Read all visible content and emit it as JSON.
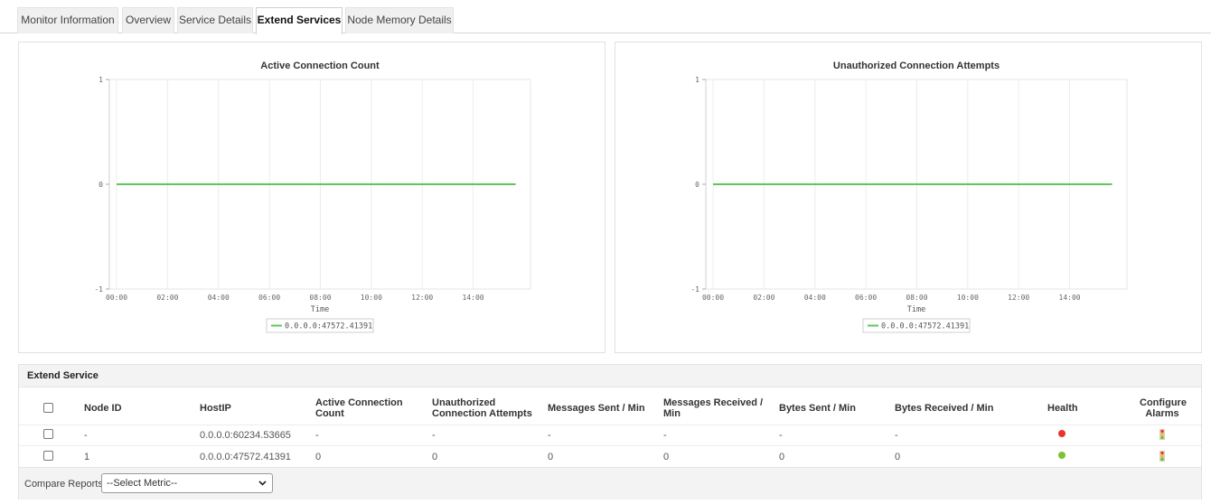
{
  "tabs": [
    {
      "label": "Monitor Information",
      "active": false
    },
    {
      "label": "Overview",
      "active": false
    },
    {
      "label": "Service Details",
      "active": false
    },
    {
      "label": "Extend Services",
      "active": true
    },
    {
      "label": "Node Memory Details",
      "active": false
    }
  ],
  "charts": [
    {
      "title": "Active Connection Count",
      "xlabel": "Time",
      "legend": "0.0.0.0:47572.41391"
    },
    {
      "title": "Unauthorized Connection Attempts",
      "xlabel": "Time",
      "legend": "0.0.0.0:47572.41391"
    }
  ],
  "chart_data": [
    {
      "type": "line",
      "title": "Active Connection Count",
      "xlabel": "Time",
      "ylabel": "",
      "x_ticks": [
        "00:00",
        "02:00",
        "04:00",
        "06:00",
        "08:00",
        "10:00",
        "12:00",
        "14:00"
      ],
      "y_ticks": [
        "1",
        "0",
        "-1"
      ],
      "ylim": [
        -1,
        1
      ],
      "grid": true,
      "legend_position": "bottom",
      "series": [
        {
          "name": "0.0.0.0:47572.41391",
          "color": "#5cc85c",
          "x": [
            "00:00",
            "15:40"
          ],
          "values": [
            0,
            0
          ]
        }
      ]
    },
    {
      "type": "line",
      "title": "Unauthorized Connection Attempts",
      "xlabel": "Time",
      "ylabel": "",
      "x_ticks": [
        "00:00",
        "02:00",
        "04:00",
        "06:00",
        "08:00",
        "10:00",
        "12:00",
        "14:00"
      ],
      "y_ticks": [
        "1",
        "0",
        "-1"
      ],
      "ylim": [
        -1,
        1
      ],
      "grid": true,
      "legend_position": "bottom",
      "series": [
        {
          "name": "0.0.0.0:47572.41391",
          "color": "#5cc85c",
          "x": [
            "00:00",
            "15:40"
          ],
          "values": [
            0,
            0
          ]
        }
      ]
    }
  ],
  "table": {
    "title": "Extend Service",
    "columns": {
      "node_id": "Node ID",
      "host_ip": "HostIP",
      "active_l1": "Active Connection",
      "active_l2": "Count",
      "unauth_l1": "Unauthorized",
      "unauth_l2": "Connection Attempts",
      "msg_sent": "Messages Sent / Min",
      "msg_recv_l1": "Messages Received /",
      "msg_recv_l2": "Min",
      "bytes_sent": "Bytes Sent / Min",
      "bytes_recv": "Bytes Received / Min",
      "health": "Health",
      "alarms_l1": "Configure",
      "alarms_l2": "Alarms"
    },
    "rows": [
      {
        "node_id": "-",
        "host_ip": "0.0.0.0:60234.53665",
        "active": "-",
        "unauth": "-",
        "msg_sent": "-",
        "msg_recv": "-",
        "bytes_sent": "-",
        "bytes_recv": "-",
        "health": "critical",
        "health_color": "#e8342a"
      },
      {
        "node_id": "1",
        "host_ip": "0.0.0.0:47572.41391",
        "active": "0",
        "unauth": "0",
        "msg_sent": "0",
        "msg_recv": "0",
        "bytes_sent": "0",
        "bytes_recv": "0",
        "health": "clear",
        "health_color": "#7cc42e"
      }
    ]
  },
  "footer": {
    "compare_label": "Compare Reports",
    "select_value": "--Select Metric--"
  },
  "colors": {
    "series_line": "#5cc85c",
    "health_critical": "#e8342a",
    "health_clear": "#7cc42e"
  }
}
